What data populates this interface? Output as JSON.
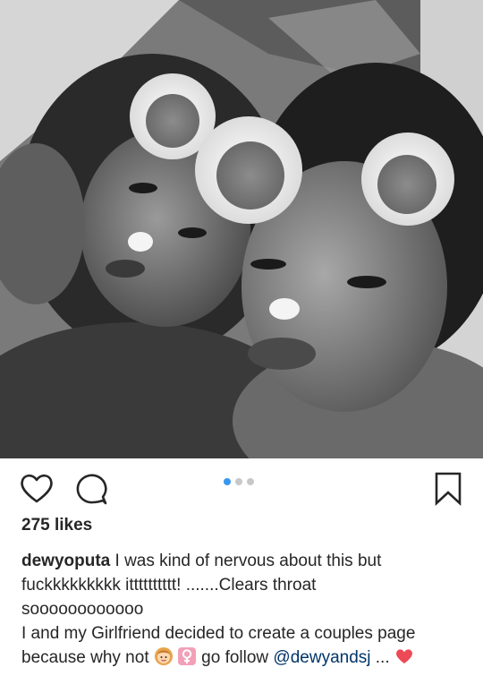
{
  "post": {
    "username": "dewyoputa",
    "likes_text": "275 likes",
    "caption_line1": " I was kind of nervous about this but",
    "caption_line2": "fuckkkkkkkkk itttttttttt! .......Clears throat",
    "caption_line3": "soooooooooooo",
    "caption_line4": "I and my Girlfriend decided to create a couples page",
    "caption_line5_start": "because why not ",
    "caption_line5_mid": " go follow ",
    "mention": "@dewyandsj",
    "ellipsis": " ... ",
    "carousel": {
      "count": 3,
      "active_index": 0
    }
  },
  "icons": {
    "like": "heart-outline-icon",
    "comment": "comment-bubble-icon",
    "save": "bookmark-outline-icon",
    "emoji_1": "woman-emoji",
    "emoji_2": "female-sign-emoji",
    "emoji_3": "red-heart-emoji"
  },
  "colors": {
    "active_dot": "#3897f0",
    "inactive_dot": "#c8c8c8",
    "text": "#262626",
    "mention": "#003569",
    "heart": "#ed4956"
  }
}
